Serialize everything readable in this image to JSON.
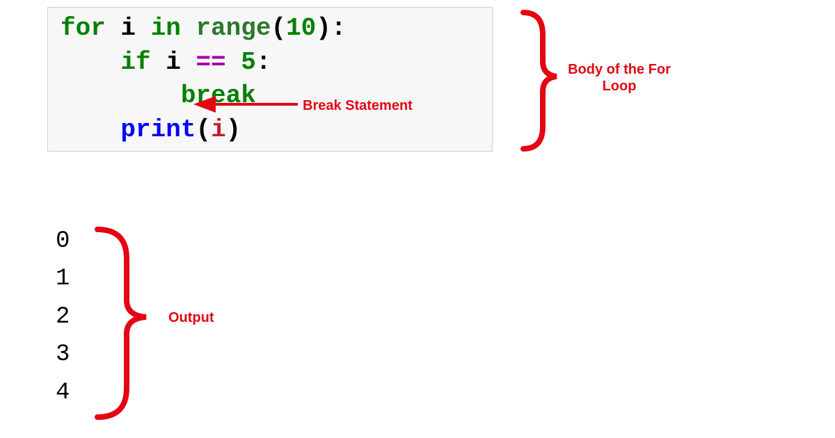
{
  "code": {
    "line1": {
      "kw_for": "for",
      "var": " i ",
      "kw_in": "in",
      "fn": " range",
      "lpar": "(",
      "arg": "10",
      "rpar_colon": "):"
    },
    "line2": {
      "indent": "    ",
      "kw_if": "if",
      "var": " i ",
      "op": "==",
      "space": " ",
      "num": "5",
      "colon": ":"
    },
    "line3": {
      "indent": "        ",
      "kw_break": "break"
    },
    "line4": {
      "indent": "    ",
      "fn": "print",
      "lpar": "(",
      "arg": "i",
      "rpar": ")"
    }
  },
  "output": {
    "lines": [
      "0",
      "1",
      "2",
      "3",
      "4"
    ]
  },
  "annotations": {
    "break_label": "Break Statement",
    "body_label_1": "Body of the For",
    "body_label_2": "Loop",
    "output_label": "Output"
  },
  "colors": {
    "annotation_red": "#e30613"
  }
}
